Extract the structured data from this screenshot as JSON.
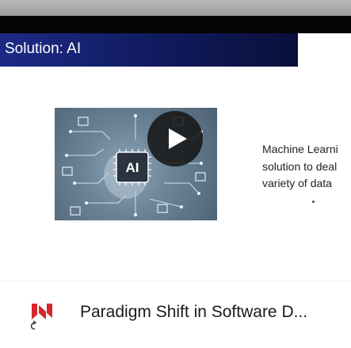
{
  "slide": {
    "title": "Solution: AI",
    "body_lines": [
      "Machine Learni",
      "solution to deal",
      "variety of data"
    ],
    "image_badge": "AI"
  },
  "player": {
    "play_icon": "play-icon"
  },
  "footer": {
    "logo_icon": "channel-logo-icon",
    "video_title": "Paradigm Shift in Software D..."
  },
  "colors": {
    "title_bar": "#1c2a86",
    "logo_red": "#d6262b",
    "play_bg": "#141414"
  }
}
